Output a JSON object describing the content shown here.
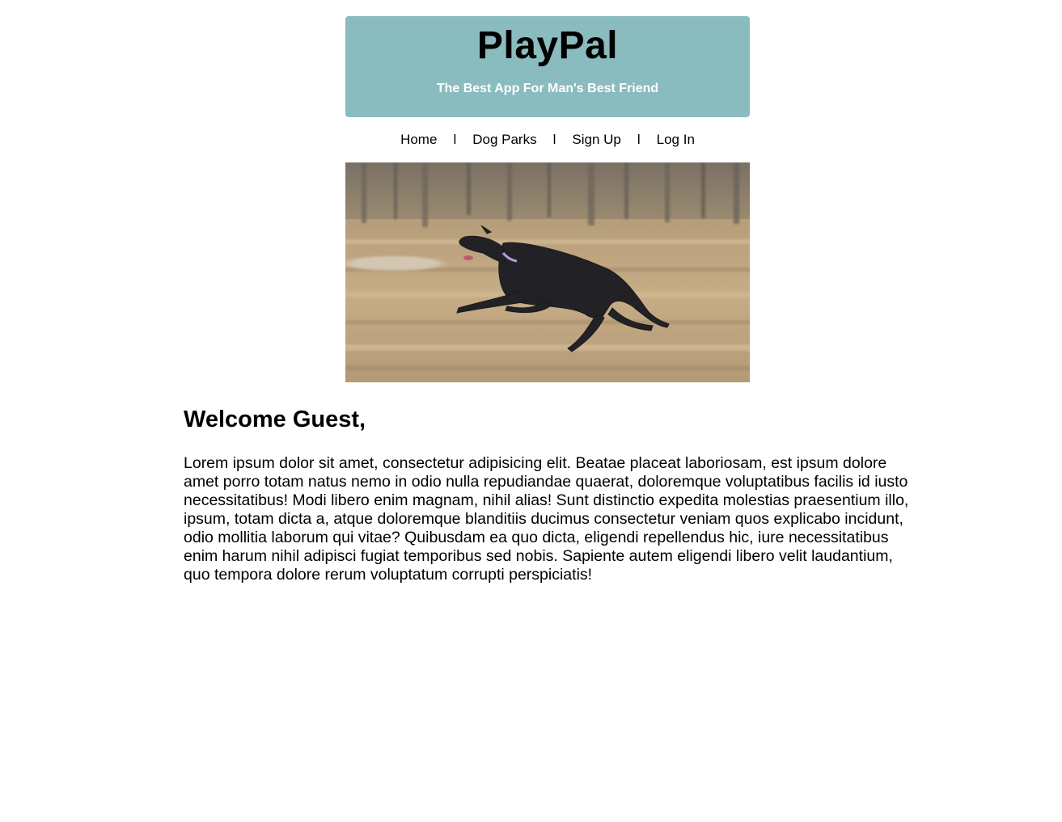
{
  "header": {
    "title": "PlayPal",
    "tagline": "The Best App For Man's Best Friend",
    "background_color": "#8abbbf"
  },
  "nav": {
    "items": [
      {
        "label": "Home"
      },
      {
        "label": "Dog Parks"
      },
      {
        "label": "Sign Up"
      },
      {
        "label": "Log In"
      }
    ],
    "separator": "l"
  },
  "hero_image": {
    "subject": "black dog running across a field"
  },
  "main": {
    "heading": "Welcome Guest,",
    "paragraph": "Lorem ipsum dolor sit amet, consectetur adipisicing elit. Beatae placeat laboriosam, est ipsum dolore amet porro totam natus nemo in odio nulla repudiandae quaerat, doloremque voluptatibus facilis id iusto necessitatibus! Modi libero enim magnam, nihil alias! Sunt distinctio expedita molestias praesentium illo, ipsum, totam dicta a, atque doloremque blanditiis ducimus consectetur veniam quos explicabo incidunt, odio mollitia laborum qui vitae? Quibusdam ea quo dicta, eligendi repellendus hic, iure necessitatibus enim harum nihil adipisci fugiat temporibus sed nobis. Sapiente autem eligendi libero velit laudantium, quo tempora dolore rerum voluptatum corrupti perspiciatis!"
  }
}
